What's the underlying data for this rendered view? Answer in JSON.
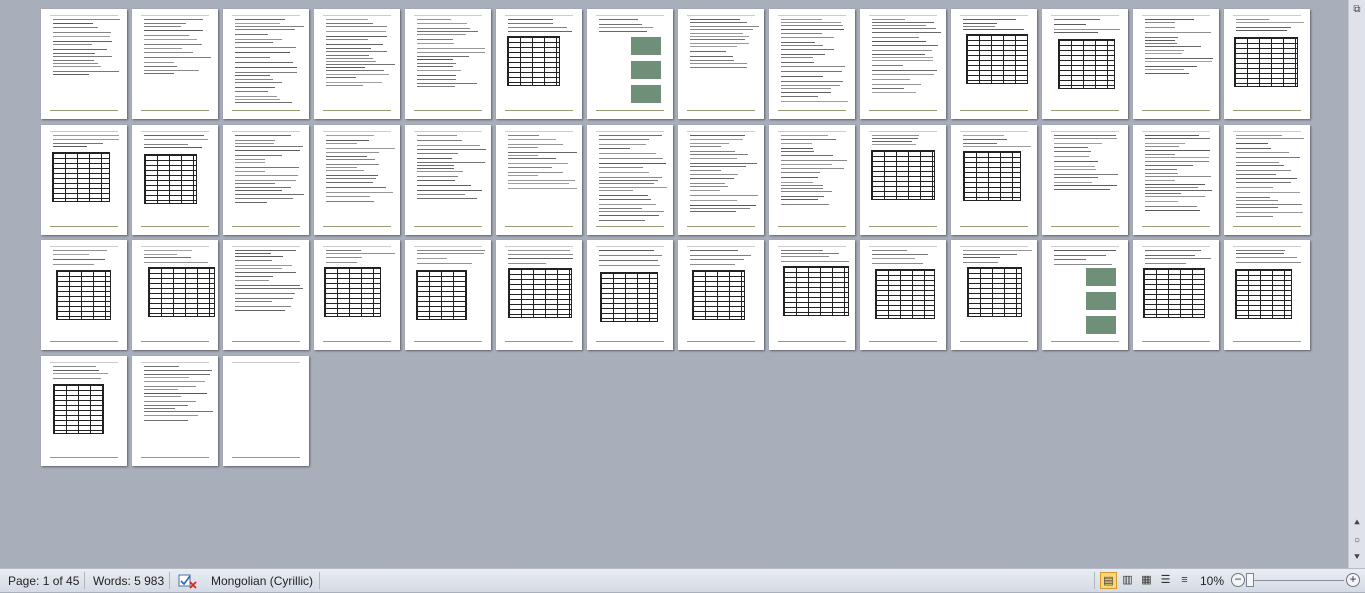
{
  "statusbar": {
    "page_indicator": "Page: 1 of 45",
    "word_count": "Words: 5 983",
    "spellcheck_icon": "proofing-check-icon",
    "language": "Mongolian (Cyrillic)",
    "zoom_level": "10%",
    "view_buttons": [
      {
        "name": "print-layout",
        "icon": "print-layout-icon",
        "glyph": "▤",
        "active": true
      },
      {
        "name": "full-screen-reading",
        "icon": "reading-view-icon",
        "glyph": "▥",
        "active": false
      },
      {
        "name": "web-layout",
        "icon": "web-layout-icon",
        "glyph": "▦",
        "active": false
      },
      {
        "name": "outline",
        "icon": "outline-view-icon",
        "glyph": "☰",
        "active": false
      },
      {
        "name": "draft",
        "icon": "draft-view-icon",
        "glyph": "≡",
        "active": false
      }
    ],
    "zoom_out_glyph": "−",
    "zoom_in_glyph": "+"
  },
  "document": {
    "pages": [
      "text",
      "text",
      "text",
      "text",
      "text",
      "table",
      "images",
      "text",
      "text",
      "text",
      "table",
      "table",
      "text",
      "table",
      "diagram",
      "table",
      "text",
      "text",
      "text",
      "text",
      "text",
      "text",
      "text",
      "table",
      "table",
      "text",
      "text",
      "text",
      "table",
      "table",
      "text",
      "table",
      "table",
      "table",
      "table",
      "table",
      "table",
      "table",
      "table",
      "images",
      "table",
      "table",
      "table",
      "text",
      "blank"
    ]
  },
  "vscroll": {
    "top_glyph": "⧉",
    "prev_glyph": "⯅",
    "select_glyph": "○",
    "next_glyph": "⯆"
  }
}
